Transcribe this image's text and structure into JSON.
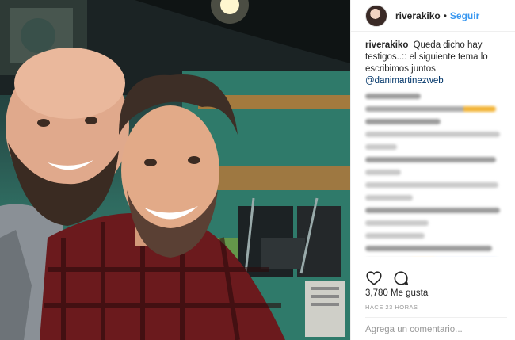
{
  "post": {
    "username": "riverakiko",
    "separator": "•",
    "follow_label": "Seguir"
  },
  "caption": {
    "user": "riverakiko",
    "text": "Queda dicho hay testigos..:: el siguiente tema lo escribimos juntos",
    "mention": "@danimartinezweb"
  },
  "stats": {
    "likes": "3,780 Me gusta",
    "timestamp": "HACE 23 HORAS"
  },
  "comment_box": {
    "placeholder": "Agrega un comentario..."
  },
  "icons": [
    "heart-icon",
    "comment-icon"
  ]
}
